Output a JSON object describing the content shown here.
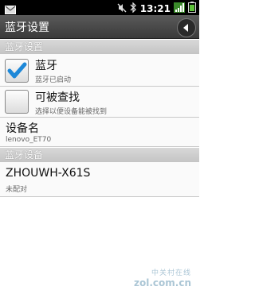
{
  "status_bar": {
    "time": "13:21",
    "icons": [
      "mail-icon",
      "mute-icon",
      "bluetooth-icon",
      "signal-icon",
      "battery-icon"
    ]
  },
  "title_bar": {
    "title": "蓝牙设置"
  },
  "sections": {
    "bluetooth_settings": "蓝牙设置",
    "bluetooth_devices": "蓝牙设备"
  },
  "settings": {
    "bluetooth": {
      "title": "蓝牙",
      "subtitle": "蓝牙已启动",
      "checked": true
    },
    "discoverable": {
      "title": "可被查找",
      "subtitle": "选择以便设备能被找到",
      "checked": false
    },
    "device_name": {
      "title": "设备名",
      "subtitle": "lenovo_ET70"
    }
  },
  "devices": [
    {
      "name": "ZHOUWH-X61S",
      "status": "未配对"
    }
  ],
  "watermark": {
    "line1": "中关村在线",
    "line2": "zol.com.cn"
  },
  "colors": {
    "accent_check": "#1e88d8",
    "title_bar": "#4a4a4a",
    "section_header": "#cfcfcf"
  }
}
